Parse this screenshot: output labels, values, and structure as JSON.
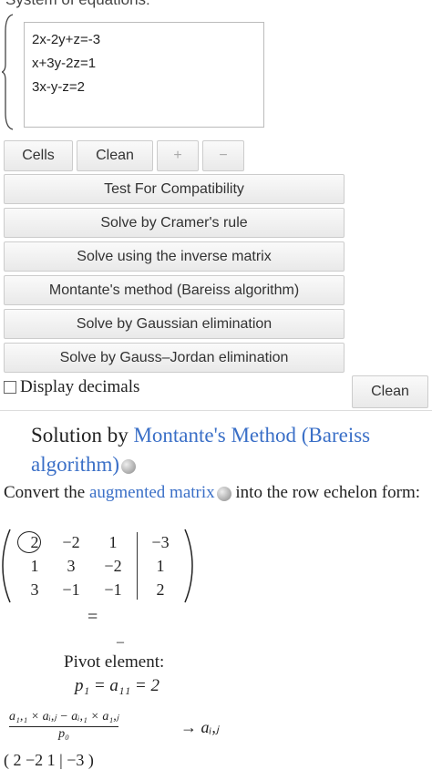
{
  "system": {
    "label": "System of equations:",
    "equations": [
      "2x-2y+z=-3",
      "x+3y-2z=1",
      "3x-y-z=2"
    ]
  },
  "toolbar": {
    "cells": "Cells",
    "clean": "Clean",
    "plus": "+",
    "minus": "−"
  },
  "methods": [
    "Test For Compatibility",
    "Solve by Cramer's rule",
    "Solve using the inverse matrix",
    "Montante's method (Bareiss algorithm)",
    "Solve by Gaussian elimination",
    "Solve by Gauss–Jordan elimination"
  ],
  "options": {
    "display_decimals": "Display decimals",
    "clean": "Clean"
  },
  "solution": {
    "prefix": "Solution by ",
    "method_link": "Montante's Method (Bareiss algorithm)",
    "convert_prefix": "Convert the ",
    "matrix_link": "augmented matrix",
    "convert_suffix": " into the row echelon form:",
    "matrix": [
      [
        "2",
        "−2",
        "1",
        "−3"
      ],
      [
        "1",
        "3",
        "−2",
        "1"
      ],
      [
        "3",
        "−1",
        "−1",
        "2"
      ]
    ],
    "equiv": "=",
    "dash": "–",
    "pivot_label": "Pivot element:",
    "pivot_formula": "p₁ = a₁₁ = 2",
    "fraction_num": "a₁,₁ × aᵢ,ⱼ − aᵢ,₁ × a₁,ⱼ",
    "fraction_den": "p₀",
    "arrow_target": "→ aᵢ,ⱼ",
    "next_row": "( 2   −2   1  |  −3 )"
  }
}
